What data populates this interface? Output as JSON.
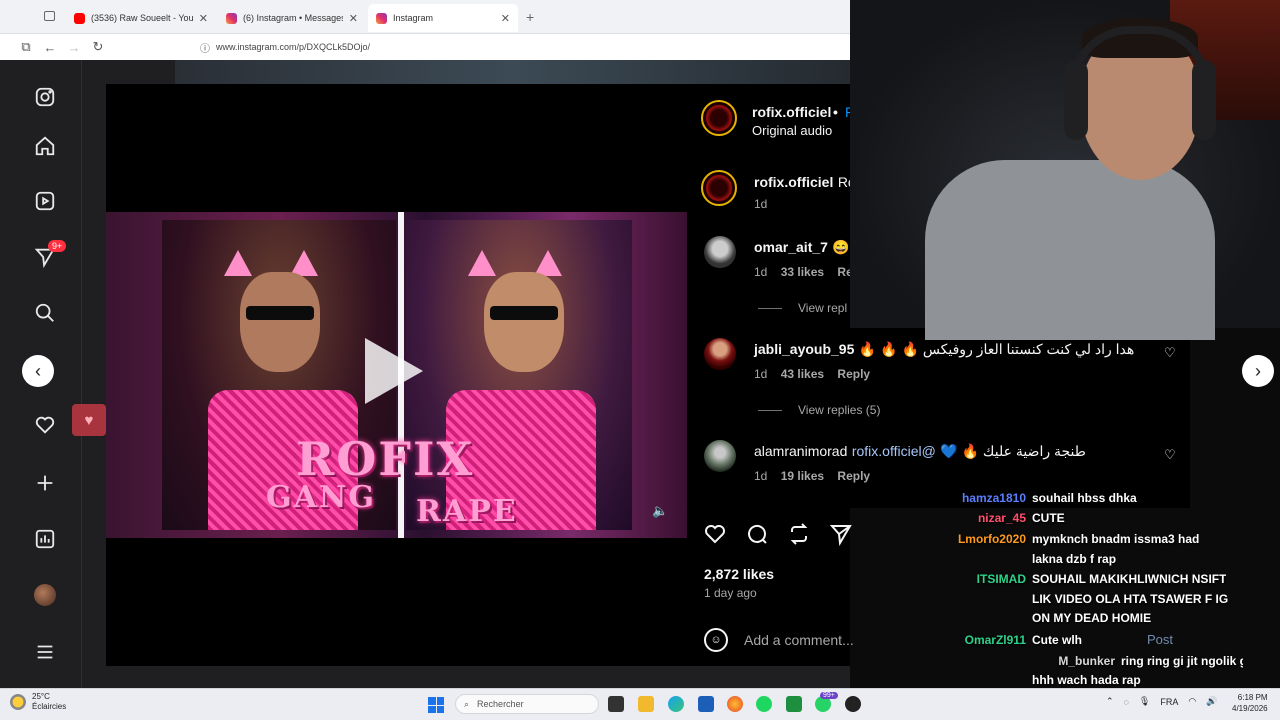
{
  "browser": {
    "tabs": [
      {
        "title": "(3536) Raw Soueelt - YouTube",
        "icon": "youtube-icon",
        "color": "#ff0000"
      },
      {
        "title": "(6) Instagram • Messages",
        "icon": "instagram-icon",
        "color": "#e1306c"
      },
      {
        "title": "Instagram",
        "icon": "instagram-icon",
        "color": "#e1306c"
      }
    ],
    "new_tab": "+",
    "url": "www.instagram.com/p/DXQCLk5DOjo/"
  },
  "sidebar": {
    "notification_badge": "9+"
  },
  "post": {
    "thumbnail_text_main": "ROFIX",
    "thumbnail_text_left": "GANG",
    "thumbnail_text_right": "RAPE",
    "author": "rofix.officiel",
    "author_sep": "•",
    "follow_hint": "F",
    "audio": "Original audio",
    "caption_user": "rofix.officiel",
    "caption_text": "Rof",
    "caption_time": "1d",
    "likes": "2,872 likes",
    "time_ago": "1 day ago",
    "add_comment_placeholder": "Add a comment...",
    "post_label": "Post"
  },
  "comments": [
    {
      "user": "omar_ait_7",
      "text": "😄",
      "time": "1d",
      "likes": "33 likes",
      "reply": "Rep",
      "view_replies": "View repl"
    },
    {
      "user": "jabli_ayoub_95",
      "text": "🔥 🔥 🔥 هدا راد لي كنت كنستنا العاز روفيكس",
      "time": "1d",
      "likes": "43 likes",
      "reply": "Reply",
      "view_replies": "View replies (5)"
    },
    {
      "user": "alamranimorad",
      "mention": "rofix.officiel@",
      "text": "💙 🔥 طنجة راضية عليك",
      "time": "1d",
      "likes": "19 likes",
      "reply": "Reply"
    }
  ],
  "chat": [
    {
      "name": "hamza1810",
      "color": "#5b7fff",
      "msg": "souhail hbss dhka"
    },
    {
      "name": "nizar_45",
      "color": "#ff4f6d",
      "msg": "CUTE"
    },
    {
      "name": "Lmorfo2020",
      "color": "#ff9a1f",
      "msg": "mymknch bnadm issma3 had"
    },
    {
      "name": "",
      "color": "#ffffff",
      "msg": "lakna dzb f rap"
    },
    {
      "name": "ITSIMAD",
      "color": "#2ed18a",
      "msg": "SOUHAIL MAKIKHLIWNICH NSIFT"
    },
    {
      "name": "",
      "color": "#ffffff",
      "msg": "LIK VIDEO OLA HTA TSAWER F IG"
    },
    {
      "name": "",
      "color": "#ffffff",
      "msg": "ON MY DEAD HOMIE"
    },
    {
      "name": "OmarZl911",
      "color": "#2ed18a",
      "msg": "Cute wlh"
    },
    {
      "name": "M_bunker",
      "color": "#d8d8d8",
      "msg": "ring ring gi jit ngolik g"
    },
    {
      "name": "",
      "color": "#ffffff",
      "msg": "hhh wach hada rap"
    }
  ],
  "taskbar": {
    "temp": "25°C",
    "weather": "Éclaircies",
    "search_placeholder": "Rechercher",
    "badge": "99+",
    "lang": "FRA",
    "time": "6:18 PM",
    "date": "4/19/2026"
  }
}
